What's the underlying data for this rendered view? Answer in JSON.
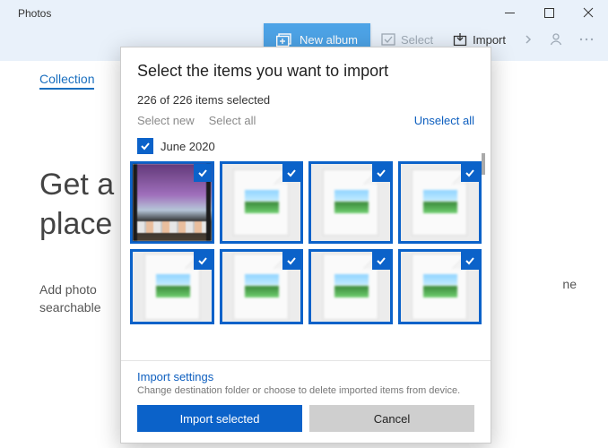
{
  "app": {
    "title": "Photos"
  },
  "ribbon": {
    "new_album": "New album",
    "select": "Select",
    "import": "Import"
  },
  "tabs": {
    "collection": "Collection"
  },
  "hero": {
    "line1": "Get a",
    "line2": "place"
  },
  "subhero": {
    "line1": "Add photo",
    "line2": "searchable"
  },
  "bg_right": {
    "text": "ne"
  },
  "modal": {
    "title": "Select the items you want to import",
    "count_text": "226 of 226 items selected",
    "select_new": "Select new",
    "select_all": "Select all",
    "unselect_all": "Unselect all",
    "group_label": "June 2020",
    "import_settings": "Import settings",
    "import_settings_desc": "Change destination folder or choose to delete imported items from device.",
    "import_btn": "Import selected",
    "cancel_btn": "Cancel",
    "selected_count": 226,
    "total_count": 226,
    "items": [
      {
        "type": "photo",
        "selected": true
      },
      {
        "type": "generic",
        "selected": true
      },
      {
        "type": "generic",
        "selected": true
      },
      {
        "type": "generic",
        "selected": true
      },
      {
        "type": "generic",
        "selected": true
      },
      {
        "type": "generic",
        "selected": true
      },
      {
        "type": "generic",
        "selected": true
      },
      {
        "type": "generic",
        "selected": true
      }
    ]
  }
}
